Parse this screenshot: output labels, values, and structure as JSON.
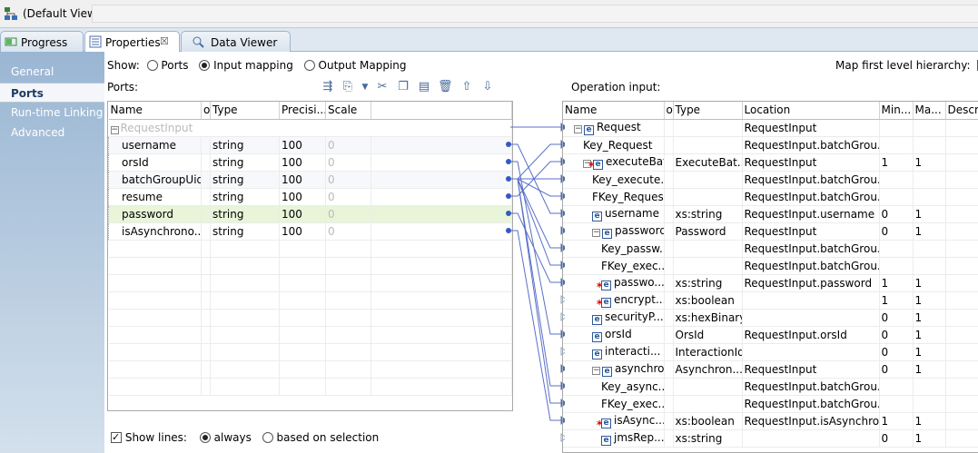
{
  "view": {
    "title": "(Default View)"
  },
  "tabs": [
    {
      "label": "Progress",
      "icon": "progress-icon"
    },
    {
      "label": "Properties",
      "icon": "properties-icon",
      "close": "☒"
    },
    {
      "label": "Data Viewer",
      "icon": "data-viewer-icon"
    }
  ],
  "sidebar": {
    "items": [
      "General",
      "Ports",
      "Run-time Linking",
      "Advanced"
    ],
    "selected": "Ports"
  },
  "show": {
    "label": "Show:",
    "options": [
      "Ports",
      "Input mapping",
      "Output Mapping"
    ],
    "selected": "Input mapping",
    "map_hierarchy_label": "Map first level hierarchy:",
    "map_hierarchy_trunc": "Ir"
  },
  "ports": {
    "label": "Ports:",
    "toolbar_icons": [
      "add-port-icon",
      "new-icon",
      "dropdown-icon",
      "cut-icon",
      "copy-icon",
      "paste-icon",
      "delete-icon",
      "move-up-icon",
      "move-down-icon"
    ],
    "columns": [
      "Name",
      "o",
      "Type",
      "Precisi...",
      "Scale"
    ],
    "group": "RequestInput",
    "rows": [
      {
        "name": "username",
        "type": "string",
        "precision": "100",
        "scale": "0"
      },
      {
        "name": "orsId",
        "type": "string",
        "precision": "100",
        "scale": "0"
      },
      {
        "name": "batchGroupUid",
        "type": "string",
        "precision": "100",
        "scale": "0"
      },
      {
        "name": "resume",
        "type": "string",
        "precision": "100",
        "scale": "0"
      },
      {
        "name": "password",
        "type": "string",
        "precision": "100",
        "scale": "0"
      },
      {
        "name": "isAsynchrono...",
        "type": "string",
        "precision": "100",
        "scale": "0"
      }
    ]
  },
  "operation": {
    "label": "Operation input:",
    "columns": [
      "Name",
      "o",
      "Type",
      "Location",
      "Min...",
      "Ma...",
      "Descrip"
    ],
    "rows": [
      {
        "indent": 0,
        "toggle": "⊟",
        "icon": "e",
        "name": "Request",
        "type": "",
        "location": "RequestInput",
        "min": "",
        "max": "",
        "req": false,
        "arrow": "solid"
      },
      {
        "indent": 1,
        "toggle": "",
        "icon": "",
        "name": "Key_Request",
        "type": "",
        "location": "RequestInput.batchGrou...",
        "min": "",
        "max": "",
        "req": false,
        "arrow": "solid"
      },
      {
        "indent": 1,
        "toggle": "⊟",
        "icon": "e",
        "name": "executeBat...",
        "type": "ExecuteBat...",
        "location": "RequestInput",
        "min": "1",
        "max": "1",
        "req": true,
        "arrow": "solid"
      },
      {
        "indent": 2,
        "toggle": "",
        "icon": "",
        "name": "Key_execute...",
        "type": "",
        "location": "RequestInput.batchGrou...",
        "min": "",
        "max": "",
        "req": false,
        "arrow": "solid"
      },
      {
        "indent": 2,
        "toggle": "",
        "icon": "",
        "name": "FKey_Request",
        "type": "",
        "location": "RequestInput.batchGrou...",
        "min": "",
        "max": "",
        "req": false,
        "arrow": "solid"
      },
      {
        "indent": 2,
        "toggle": "",
        "icon": "e",
        "name": "username",
        "type": "xs:string",
        "location": "RequestInput.username",
        "min": "0",
        "max": "1",
        "req": false,
        "arrow": "solid"
      },
      {
        "indent": 2,
        "toggle": "⊟",
        "icon": "e",
        "name": "password",
        "type": "Password",
        "location": "RequestInput",
        "min": "0",
        "max": "1",
        "req": false,
        "arrow": "solid"
      },
      {
        "indent": 3,
        "toggle": "",
        "icon": "",
        "name": "Key_passw...",
        "type": "",
        "location": "RequestInput.batchGrou...",
        "min": "",
        "max": "",
        "req": false,
        "arrow": "solid"
      },
      {
        "indent": 3,
        "toggle": "",
        "icon": "",
        "name": "FKey_exec...",
        "type": "",
        "location": "RequestInput.batchGrou...",
        "min": "",
        "max": "",
        "req": false,
        "arrow": "solid"
      },
      {
        "indent": 3,
        "toggle": "",
        "icon": "e",
        "name": "passwo...",
        "type": "xs:string",
        "location": "RequestInput.password",
        "min": "1",
        "max": "1",
        "req": true,
        "arrow": "solid"
      },
      {
        "indent": 3,
        "toggle": "",
        "icon": "e",
        "name": "encrypt...",
        "type": "xs:boolean",
        "location": "",
        "min": "1",
        "max": "1",
        "req": true,
        "arrow": "hollow"
      },
      {
        "indent": 2,
        "toggle": "",
        "icon": "e",
        "name": "securityP...",
        "type": "xs:hexBinary",
        "location": "",
        "min": "0",
        "max": "1",
        "req": false,
        "arrow": "hollow"
      },
      {
        "indent": 2,
        "toggle": "",
        "icon": "e",
        "name": "orsId",
        "type": "OrsId",
        "location": "RequestInput.orsId",
        "min": "0",
        "max": "1",
        "req": false,
        "arrow": "solid"
      },
      {
        "indent": 2,
        "toggle": "",
        "icon": "e",
        "name": "interacti...",
        "type": "InteractionId",
        "location": "",
        "min": "0",
        "max": "1",
        "req": false,
        "arrow": "hollow"
      },
      {
        "indent": 2,
        "toggle": "⊟",
        "icon": "e",
        "name": "asynchro...",
        "type": "Asynchron...",
        "location": "RequestInput",
        "min": "0",
        "max": "1",
        "req": false,
        "arrow": "solid"
      },
      {
        "indent": 3,
        "toggle": "",
        "icon": "",
        "name": "Key_async...",
        "type": "",
        "location": "RequestInput.batchGrou...",
        "min": "",
        "max": "",
        "req": false,
        "arrow": "solid"
      },
      {
        "indent": 3,
        "toggle": "",
        "icon": "",
        "name": "FKey_exec...",
        "type": "",
        "location": "RequestInput.batchGrou...",
        "min": "",
        "max": "",
        "req": false,
        "arrow": "solid"
      },
      {
        "indent": 3,
        "toggle": "",
        "icon": "e",
        "name": "isAsync...",
        "type": "xs:boolean",
        "location": "RequestInput.isAsynchro...",
        "min": "1",
        "max": "1",
        "req": true,
        "arrow": "solid"
      },
      {
        "indent": 3,
        "toggle": "",
        "icon": "e",
        "name": "jmsRep...",
        "type": "xs:string",
        "location": "",
        "min": "0",
        "max": "1",
        "req": false,
        "arrow": "hollow"
      }
    ]
  },
  "bottom": {
    "show_lines_label": "Show lines:",
    "options": [
      "always",
      "based on selection"
    ],
    "selected": "always"
  },
  "colors": {
    "accent": "#3758c9",
    "sidebar_top": "#9ab6d3",
    "highlight_row": "#e8f5d9"
  }
}
